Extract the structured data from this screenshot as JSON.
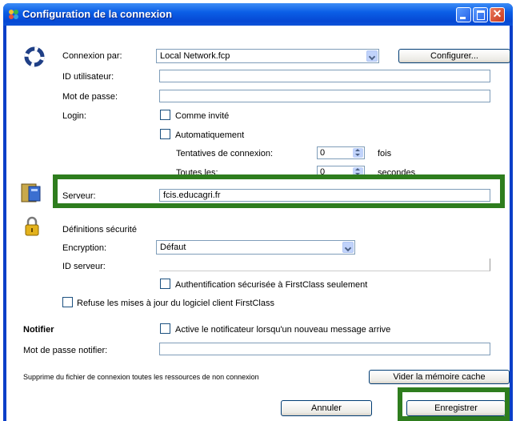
{
  "window": {
    "title": "Configuration de la connexion"
  },
  "connection": {
    "via_label": "Connexion par:",
    "via_value": "Local Network.fcp",
    "configure_button": "Configurer...",
    "user_id_label": "ID utilisateur:",
    "user_id_value": "",
    "password_label": "Mot de passe:",
    "password_value": "",
    "login_label": "Login:",
    "guest_label": "Comme invité",
    "auto_label": "Automatiquement",
    "attempts_label": "Tentatives de connexion:",
    "attempts_value": "0",
    "attempts_unit": "fois",
    "every_label": "Toutes les:",
    "every_value": "0",
    "every_unit": "secondes"
  },
  "server": {
    "label": "Serveur:",
    "value": "fcis.educagri.fr"
  },
  "security": {
    "heading": "Définitions sécurité",
    "encryption_label": "Encryption:",
    "encryption_value": "Défaut",
    "server_id_label": "ID serveur:",
    "server_id_value": "",
    "secure_auth_label": "Authentification sécurisée à FirstClass seulement",
    "refuse_updates_label": "Refuse les mises à jour du logiciel client FirstClass"
  },
  "notifier": {
    "heading": "Notifier",
    "activate_label": "Active le notificateur lorsqu'un nouveau message arrive",
    "password_label": "Mot de passe notifier:",
    "password_value": ""
  },
  "cache": {
    "description": "Supprime du fichier de connexion toutes les ressources de non connexion",
    "clear_button": "Vider la mémoire cache"
  },
  "actions": {
    "cancel": "Annuler",
    "save": "Enregistrer"
  },
  "colors": {
    "highlight": "#2e7d1e",
    "titlebar": "#0b5ee6"
  }
}
